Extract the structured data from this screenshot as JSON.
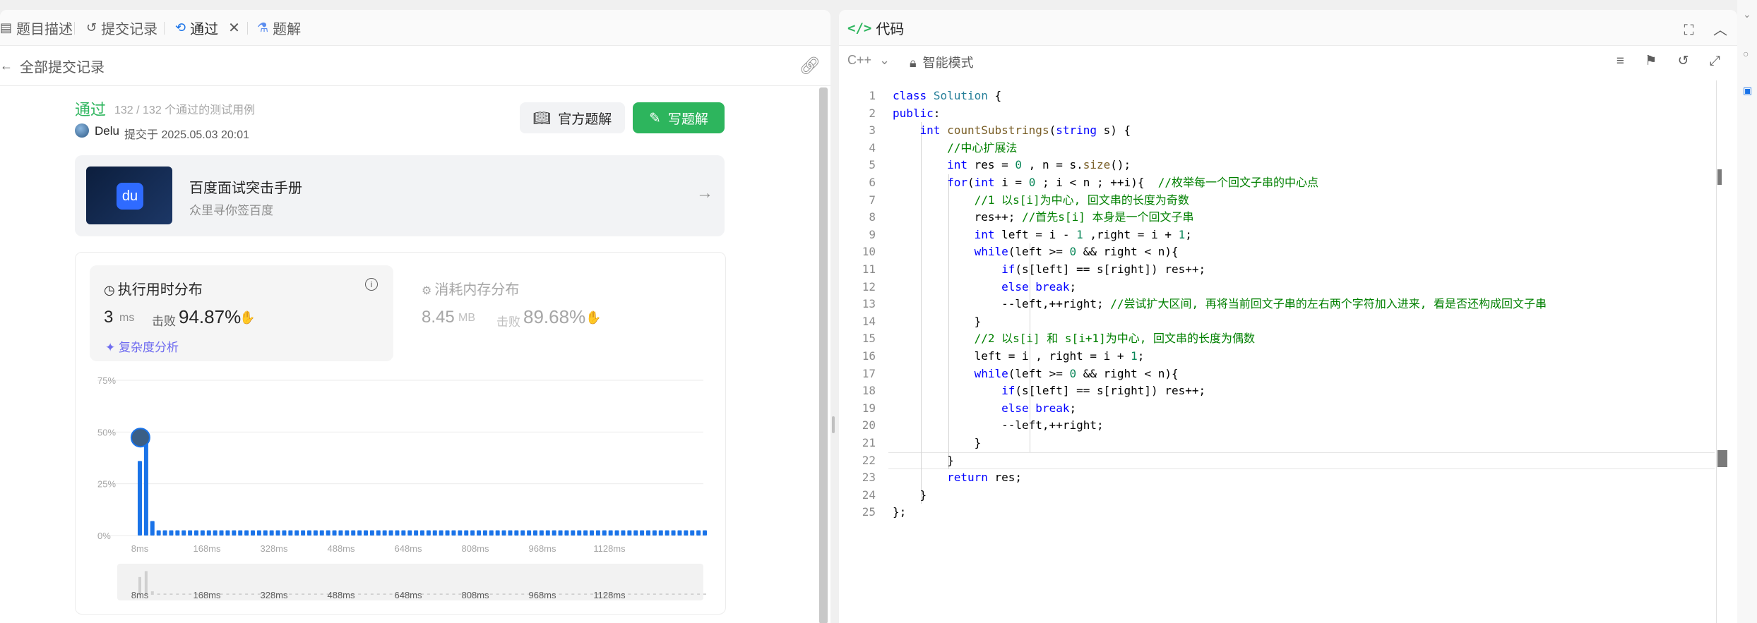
{
  "tabs": [
    {
      "label": "题目描述",
      "icon": "description-icon"
    },
    {
      "label": "提交记录",
      "icon": "history-icon"
    },
    {
      "label": "通过",
      "icon": "clock-icon",
      "closable": true
    },
    {
      "label": "题解",
      "icon": "flask-icon"
    }
  ],
  "back_label": "全部提交记录",
  "submission": {
    "status": "通过",
    "testcases": "132 / 132 个通过的测试用例",
    "author": "Delu",
    "submitted_at": "提交于 2025.05.03 20:01"
  },
  "buttons": {
    "official": "官方题解",
    "write": "写题解"
  },
  "ad": {
    "title": "百度面试突击手册",
    "subtitle": "众里寻你签百度"
  },
  "runtime": {
    "title": "执行用时分布",
    "value": "3",
    "unit": "ms",
    "beats_label": "击败",
    "beats": "94.87%",
    "complexity": "复杂度分析"
  },
  "memory": {
    "title": "消耗内存分布",
    "value": "8.45",
    "unit": "MB",
    "beats_label": "击败",
    "beats": "89.68%"
  },
  "chart_data": {
    "type": "bar",
    "ytick_labels": [
      "75%",
      "50%",
      "25%",
      "0%"
    ],
    "yticks": [
      75,
      50,
      25,
      0
    ],
    "ylim": [
      0,
      75
    ],
    "xtick_labels": [
      "8ms",
      "168ms",
      "328ms",
      "488ms",
      "648ms",
      "808ms",
      "968ms",
      "1128ms"
    ],
    "values": [
      36,
      48,
      7,
      2.5,
      2.5,
      2.5,
      2.5,
      2.5,
      2.5,
      2.5,
      2.5,
      2.5,
      2.5,
      2.5,
      2.5,
      2.5,
      2.5,
      2.5,
      2.5,
      2.5,
      2.5,
      2.5,
      2.5,
      2.5,
      2.5,
      2.5,
      2.5,
      2.5,
      2.5,
      2.5,
      2.5,
      2.5,
      2.5,
      2.5,
      2.5,
      2.5,
      2.5,
      2.5,
      2.5,
      2.5,
      2.5,
      2.5,
      2.5,
      2.5,
      2.5,
      2.5,
      2.5,
      2.5,
      2.5,
      2.5,
      2.5,
      2.5,
      2.5,
      2.5,
      2.5,
      2.5,
      2.5,
      2.5,
      2.5,
      2.5,
      2.5,
      2.5,
      2.5,
      2.5,
      2.5,
      2.5,
      2.5,
      2.5,
      2.5,
      2.5,
      2.5,
      2.5,
      2.5,
      2.5,
      2.5,
      2.5,
      2.5,
      2.5,
      2.5,
      2.5,
      2.5,
      2.5,
      2.5,
      2.5,
      2.5,
      2.5,
      2.5,
      2.5,
      2.5,
      2.5,
      2.5
    ],
    "highlight_index": 1,
    "bar_color": "#1a73e8",
    "grid": true,
    "overview": true
  },
  "editor": {
    "title": "代码",
    "language": "C++",
    "mode": "智能模式",
    "lines": [
      "class Solution {",
      "public:",
      "    int countSubstrings(string s) {",
      "        //中心扩展法",
      "        int res = 0 , n = s.size();",
      "        for(int i = 0 ; i < n ; ++i){  //枚举每一个回文子串的中心点",
      "            //1 以s[i]为中心, 回文串的长度为奇数",
      "            res++; //首先s[i] 本身是一个回文子串",
      "            int left = i - 1 ,right = i + 1;",
      "            while(left >= 0 && right < n){",
      "                if(s[left] == s[right]) res++;",
      "                else break;",
      "                --left,++right; //尝试扩大区间, 再将当前回文子串的左右两个字符加入进来, 看是否还构成回文子串",
      "            }",
      "            //2 以s[i] 和 s[i+1]为中心, 回文串的长度为偶数",
      "            left = i , right = i + 1;",
      "            while(left >= 0 && right < n){",
      "                if(s[left] == s[right]) res++;",
      "                else break;",
      "                --left,++right;",
      "            }",
      "        }",
      "        return res;",
      "    }",
      "};"
    ],
    "current_line": 22
  },
  "colors": {
    "accent": "#2db55d",
    "chart": "#1a73e8",
    "complexity": "#6f6cf0"
  }
}
